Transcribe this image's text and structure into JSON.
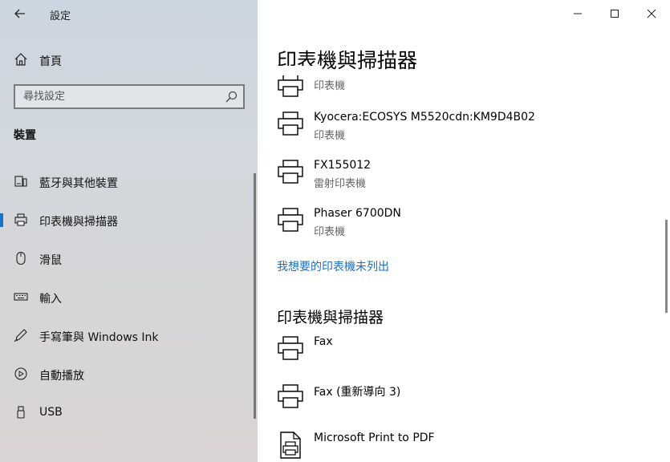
{
  "sidebar": {
    "app_title": "設定",
    "home_label": "首頁",
    "search_placeholder": "尋找設定",
    "section_label": "裝置",
    "items": [
      {
        "label": "藍牙與其他裝置",
        "icon": "bluetooth-devices-icon"
      },
      {
        "label": "印表機與掃描器",
        "icon": "printer-icon",
        "active": true
      },
      {
        "label": "滑鼠",
        "icon": "mouse-icon"
      },
      {
        "label": "輸入",
        "icon": "keyboard-icon"
      },
      {
        "label": "手寫筆與 Windows Ink",
        "icon": "pen-icon"
      },
      {
        "label": "自動播放",
        "icon": "autoplay-icon"
      },
      {
        "label": "USB",
        "icon": "usb-icon"
      }
    ]
  },
  "main": {
    "title": "印表機與掃描器",
    "printers_top": [
      {
        "name": "",
        "status": "印表機"
      },
      {
        "name": "Kyocera:ECOSYS M5520cdn:KM9D4B02",
        "status": "印表機"
      },
      {
        "name": "FX155012",
        "status": "雷射印表機"
      },
      {
        "name": "Phaser 6700DN",
        "status": "印表機"
      }
    ],
    "link_label": "我想要的印表機未列出",
    "section2_title": "印表機與掃描器",
    "printers_bottom": [
      {
        "name": "Fax",
        "status": ""
      },
      {
        "name": "Fax (重新導向 3)",
        "status": ""
      },
      {
        "name": "Microsoft Print to PDF",
        "status": ""
      }
    ]
  },
  "colors": {
    "accent": "#1a73c8",
    "link": "#1a6fc0"
  }
}
